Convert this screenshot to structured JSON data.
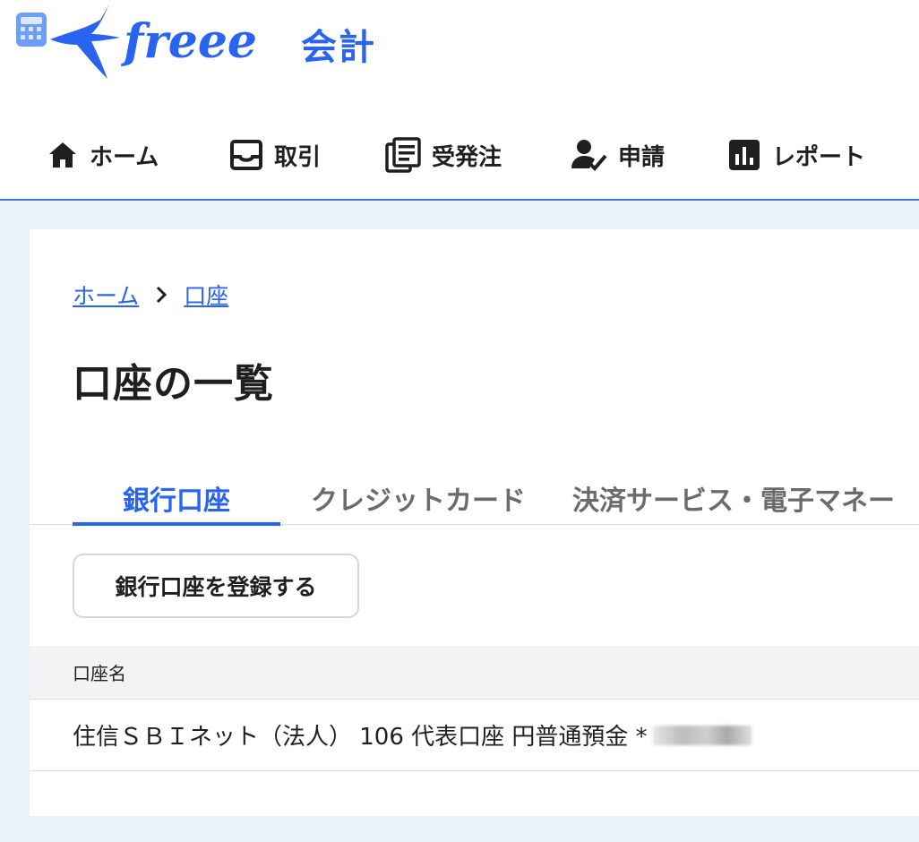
{
  "app": {
    "logo_wordmark": "freee",
    "logo_app_name": "会計",
    "brand_color": "#2864f0"
  },
  "gnav": {
    "items": [
      {
        "label": "ホーム",
        "icon": "home-icon"
      },
      {
        "label": "取引",
        "icon": "inbox-icon"
      },
      {
        "label": "受発注",
        "icon": "documents-icon"
      },
      {
        "label": "申請",
        "icon": "person-check-icon"
      },
      {
        "label": "レポート",
        "icon": "bar-chart-icon"
      }
    ]
  },
  "breadcrumb": {
    "home": "ホーム",
    "separator": ">",
    "current": "口座"
  },
  "page": {
    "title": "口座の一覧"
  },
  "tabs": {
    "items": [
      {
        "label": "銀行口座",
        "active": true
      },
      {
        "label": "クレジットカード",
        "active": false
      },
      {
        "label": "決済サービス・電子マネー",
        "active": false
      }
    ]
  },
  "actions": {
    "register_label": "銀行口座を登録する"
  },
  "table": {
    "header": "口座名",
    "rows": [
      {
        "name": "住信ＳＢＩネット（法人） 106 代表口座 円普通預金 *"
      }
    ]
  }
}
